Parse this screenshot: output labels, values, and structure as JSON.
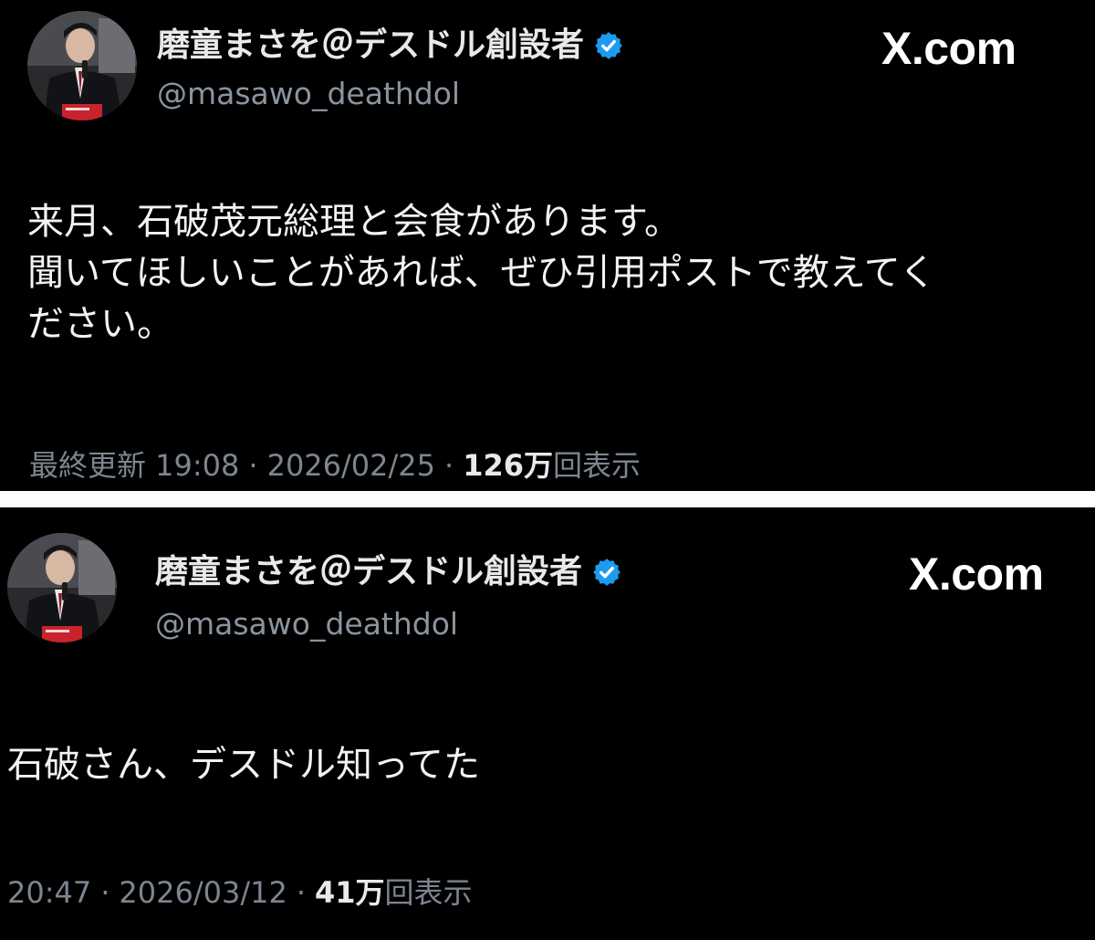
{
  "posts": [
    {
      "display_name": "磨童まさを＠デスドル創設者",
      "handle": "@masawo_deathdol",
      "site": "X.com",
      "text_lines": [
        "来月、石破茂元総理と会食があります。",
        "聞いてほしいことがあれば、ぜひ引用ポストで教えてく",
        "ださい。"
      ],
      "meta_prefix": "最終更新 19:08",
      "date": "2026/02/25",
      "view_count": "126万",
      "view_label": "回表示"
    },
    {
      "display_name": "磨童まさを＠デスドル創設者",
      "handle": "@masawo_deathdol",
      "site": "X.com",
      "text_lines": [
        "石破さん、デスドル知ってた"
      ],
      "meta_prefix": "20:47",
      "date": "2026/03/12",
      "view_count": "41万",
      "view_label": "回表示"
    }
  ],
  "icons": {
    "verified": "verified-badge-icon",
    "avatar": "profile-photo"
  },
  "colors": {
    "background": "#000000",
    "separator": "#ffffff",
    "verified_blue": "#1d9bf0",
    "secondary_text": "#7d8590"
  }
}
